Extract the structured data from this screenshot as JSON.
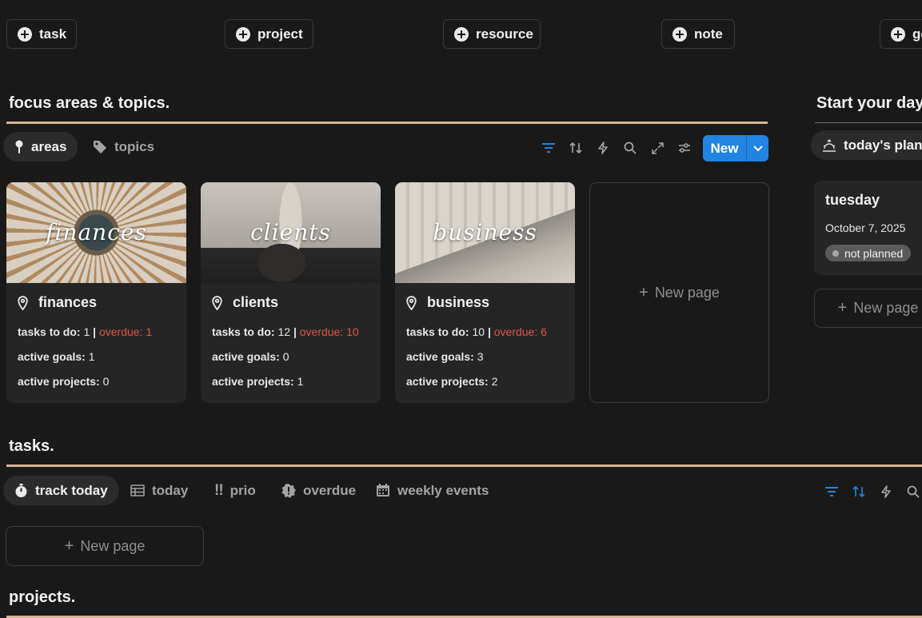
{
  "quick_add": {
    "task": "task",
    "project": "project",
    "resource": "resource",
    "note": "note",
    "goal": "goal"
  },
  "focus": {
    "title": "focus areas & topics.",
    "tabs": {
      "areas": "areas",
      "topics": "topics"
    },
    "new_label": "New",
    "cards": [
      {
        "cover_text": "finances",
        "title": "finances",
        "tasks_label": "tasks to do:",
        "tasks": "1",
        "sep": "|",
        "overdue": "overdue: 1",
        "goals_label": "active goals:",
        "goals": "1",
        "projects_label": "active projects:",
        "projects": "0"
      },
      {
        "cover_text": "clients",
        "title": "clients",
        "tasks_label": "tasks to do:",
        "tasks": "12",
        "sep": "|",
        "overdue": "overdue: 10",
        "goals_label": "active goals:",
        "goals": "0",
        "projects_label": "active projects:",
        "projects": "1"
      },
      {
        "cover_text": "business",
        "title": "business",
        "tasks_label": "tasks to do:",
        "tasks": "10",
        "sep": "|",
        "overdue": "overdue: 6",
        "goals_label": "active goals:",
        "goals": "3",
        "projects_label": "active projects:",
        "projects": "2"
      }
    ],
    "new_page": "New page"
  },
  "start_day": {
    "title": "Start your day",
    "tab": "today's planning",
    "card": {
      "day": "tuesday",
      "date": "October 7, 2025",
      "status": "not planned"
    },
    "new_page": "New page"
  },
  "tasks": {
    "title": "tasks.",
    "tabs": {
      "track_today": "track today",
      "today": "today",
      "prio": "prio",
      "overdue": "overdue",
      "weekly_events": "weekly events"
    },
    "new_page": "New page"
  },
  "projects": {
    "title": "projects."
  },
  "colors": {
    "accent": "#2383e2",
    "rule": "#d4b594",
    "overdue": "#e0554a",
    "background": "#191919",
    "card": "#252525"
  }
}
